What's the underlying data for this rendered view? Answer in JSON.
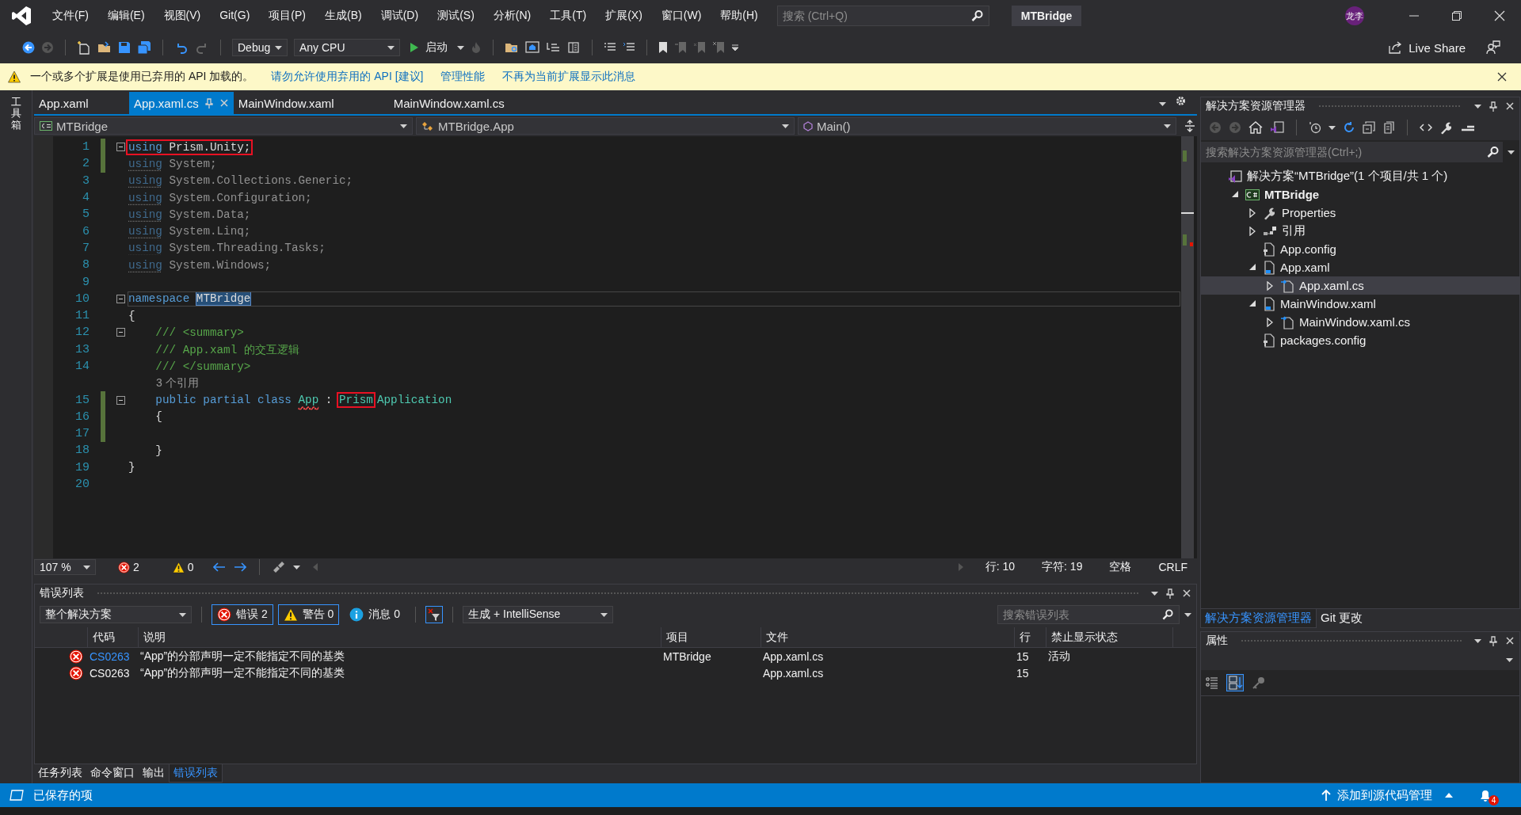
{
  "title_bar": {
    "menu": [
      "文件(F)",
      "编辑(E)",
      "视图(V)",
      "Git(G)",
      "项目(P)",
      "生成(B)",
      "调试(D)",
      "测试(S)",
      "分析(N)",
      "工具(T)",
      "扩展(X)",
      "窗口(W)",
      "帮助(H)"
    ],
    "search_placeholder": "搜索 (Ctrl+Q)",
    "title": "MTBridge",
    "avatar": "龙李"
  },
  "toolbar": {
    "configuration": "Debug",
    "platform": "Any CPU",
    "start": "启动",
    "live_share": "Live Share"
  },
  "info_bar": {
    "message": "一个或多个扩展是使用已弃用的 API 加载的。",
    "links": [
      "请勿允许使用弃用的 API [建议]",
      "管理性能",
      "不再为当前扩展显示此消息"
    ]
  },
  "toolbox_label": "工具箱",
  "editor_tabs": [
    {
      "label": "App.xaml",
      "selected": false
    },
    {
      "label": "App.xaml.cs",
      "selected": true
    },
    {
      "label": "MainWindow.xaml",
      "selected": false
    },
    {
      "label": "MainWindow.xaml.cs",
      "selected": false
    }
  ],
  "nav_bar": [
    "MTBridge",
    "MTBridge.App",
    "Main()"
  ],
  "code": [
    {
      "kind": "code",
      "n": "1",
      "changed": true,
      "fold": true,
      "unused": false,
      "current": false,
      "tokens": [
        {
          "text": "using",
          "kind": "keyword",
          "boxed": true
        },
        {
          "text": " Prism.Unity;",
          "kind": "plain",
          "boxed": true
        }
      ]
    },
    {
      "kind": "code",
      "n": "2",
      "changed": true,
      "fold": false,
      "unused": true,
      "current": false,
      "tokens": [
        {
          "text": "using",
          "kind": "keyword",
          "boxed": false
        },
        {
          "text": " System;",
          "kind": "plain",
          "boxed": false
        }
      ]
    },
    {
      "kind": "code",
      "n": "3",
      "changed": false,
      "fold": false,
      "unused": true,
      "current": false,
      "tokens": [
        {
          "text": "using",
          "kind": "keyword",
          "boxed": false
        },
        {
          "text": " System.Collections.Generic;",
          "kind": "plain",
          "boxed": false
        }
      ]
    },
    {
      "kind": "code",
      "n": "4",
      "changed": false,
      "fold": false,
      "unused": true,
      "current": false,
      "tokens": [
        {
          "text": "using",
          "kind": "keyword",
          "boxed": false
        },
        {
          "text": " System.Configuration;",
          "kind": "plain",
          "boxed": false
        }
      ]
    },
    {
      "kind": "code",
      "n": "5",
      "changed": false,
      "fold": false,
      "unused": true,
      "current": false,
      "tokens": [
        {
          "text": "using",
          "kind": "keyword",
          "boxed": false
        },
        {
          "text": " System.Data;",
          "kind": "plain",
          "boxed": false
        }
      ]
    },
    {
      "kind": "code",
      "n": "6",
      "changed": false,
      "fold": false,
      "unused": true,
      "current": false,
      "tokens": [
        {
          "text": "using",
          "kind": "keyword",
          "boxed": false
        },
        {
          "text": " System.Linq;",
          "kind": "plain",
          "boxed": false
        }
      ]
    },
    {
      "kind": "code",
      "n": "7",
      "changed": false,
      "fold": false,
      "unused": true,
      "current": false,
      "tokens": [
        {
          "text": "using",
          "kind": "keyword",
          "boxed": false
        },
        {
          "text": " System.Threading.Tasks;",
          "kind": "plain",
          "boxed": false
        }
      ]
    },
    {
      "kind": "code",
      "n": "8",
      "changed": false,
      "fold": false,
      "unused": true,
      "current": false,
      "tokens": [
        {
          "text": "using",
          "kind": "keyword",
          "boxed": false
        },
        {
          "text": " System.Windows;",
          "kind": "plain",
          "boxed": false
        }
      ]
    },
    {
      "kind": "code",
      "n": "9",
      "changed": false,
      "fold": false,
      "current": false
    },
    {
      "kind": "code",
      "n": "10",
      "changed": false,
      "fold": true,
      "unused": false,
      "current": true,
      "tokens": [
        {
          "text": "namespace ",
          "kind": "keyword",
          "boxed": false
        },
        {
          "text": "MTBridge",
          "kind": "selection",
          "boxed": false
        }
      ]
    },
    {
      "kind": "code",
      "n": "11",
      "changed": false,
      "fold": false,
      "unused": false,
      "current": false,
      "tokens": [
        {
          "text": "{",
          "kind": "plain",
          "boxed": false
        }
      ]
    },
    {
      "kind": "code",
      "n": "12",
      "changed": false,
      "fold": true,
      "unused": false,
      "current": false,
      "tokens": [
        {
          "text": "    /// <summary>",
          "kind": "comment",
          "boxed": false
        }
      ]
    },
    {
      "kind": "code",
      "n": "13",
      "changed": false,
      "fold": false,
      "unused": false,
      "current": false,
      "tokens": [
        {
          "text": "    /// App.xaml 的交互逻辑",
          "kind": "comment",
          "boxed": false
        }
      ]
    },
    {
      "kind": "code",
      "n": "14",
      "changed": false,
      "fold": false,
      "unused": false,
      "current": false,
      "tokens": [
        {
          "text": "    /// </summary>",
          "kind": "comment",
          "boxed": false
        }
      ]
    },
    {
      "kind": "codelens",
      "text": "3 个引用"
    },
    {
      "kind": "code",
      "n": "15",
      "changed": true,
      "fold": true,
      "unused": false,
      "current": false,
      "tokens": [
        {
          "text": "    public partial class ",
          "kind": "keyword",
          "boxed": false
        },
        {
          "text": "App",
          "kind": "type-error",
          "boxed": false
        },
        {
          "text": " : ",
          "kind": "plain",
          "boxed": false
        },
        {
          "text": "Prism",
          "kind": "type",
          "boxed": true
        },
        {
          "text": "Application",
          "kind": "type",
          "boxed": false
        }
      ]
    },
    {
      "kind": "code",
      "n": "16",
      "changed": true,
      "fold": false,
      "unused": false,
      "current": false,
      "tokens": [
        {
          "text": "    {",
          "kind": "plain",
          "boxed": false
        }
      ]
    },
    {
      "kind": "code",
      "n": "17",
      "changed": true,
      "fold": false,
      "current": false
    },
    {
      "kind": "code",
      "n": "18",
      "changed": false,
      "fold": false,
      "unused": false,
      "current": false,
      "tokens": [
        {
          "text": "    }",
          "kind": "plain",
          "boxed": false
        }
      ]
    },
    {
      "kind": "code",
      "n": "19",
      "changed": false,
      "fold": false,
      "unused": false,
      "current": false,
      "tokens": [
        {
          "text": "}",
          "kind": "plain",
          "boxed": false
        }
      ]
    },
    {
      "kind": "code",
      "n": "20",
      "changed": false,
      "fold": false,
      "current": false
    }
  ],
  "editor_status": {
    "zoom": "107 %",
    "errors": "2",
    "warnings": "0",
    "line": "行: 10",
    "char": "字符: 19",
    "spaces": "空格",
    "eol": "CRLF"
  },
  "error_list": {
    "title": "错误列表",
    "scope": "整个解决方案",
    "filters": [
      {
        "kind": "error",
        "label": "错误 2",
        "selected": true
      },
      {
        "kind": "warning",
        "label": "警告 0",
        "selected": true
      },
      {
        "kind": "info",
        "label": "消息 0",
        "selected": false
      }
    ],
    "source": "生成 + IntelliSense",
    "search_placeholder": "搜索错误列表",
    "columns": [
      "代码",
      "说明",
      "项目",
      "文件",
      "行",
      "禁止显示状态"
    ],
    "rows": [
      {
        "code": "CS0263",
        "linked": true,
        "description": "“App”的分部声明一定不能指定不同的基类",
        "project": "MTBridge",
        "file": "App.xaml.cs",
        "line": "15",
        "suppression": "活动"
      },
      {
        "code": "CS0263",
        "linked": false,
        "description": "“App”的分部声明一定不能指定不同的基类",
        "file": "App.xaml.cs",
        "line": "15"
      }
    ]
  },
  "bottom_tabs": [
    {
      "label": "任务列表",
      "selected": false
    },
    {
      "label": "命令窗口",
      "selected": false
    },
    {
      "label": "输出",
      "selected": false
    },
    {
      "label": "错误列表",
      "selected": true
    }
  ],
  "solution_explorer": {
    "title": "解决方案资源管理器",
    "search_placeholder": "搜索解决方案资源管理器(Ctrl+;)",
    "tree": [
      {
        "label": "解决方案“MTBridge”(1 个项目/共 1 个)",
        "kind": "solution",
        "selected": false,
        "children": [
          {
            "label": "MTBridge",
            "kind": "project",
            "expanded": true,
            "selected": false,
            "children": [
              {
                "label": "Properties",
                "kind": "wrench",
                "expanded": false,
                "selected": false
              },
              {
                "label": "引用",
                "kind": "references",
                "expanded": false,
                "selected": false
              },
              {
                "label": "App.config",
                "kind": "config",
                "selected": false
              },
              {
                "label": "App.xaml",
                "kind": "xaml",
                "expanded": true,
                "selected": false,
                "children": [
                  {
                    "label": "App.xaml.cs",
                    "kind": "cs",
                    "expanded": false,
                    "selected": true
                  }
                ]
              },
              {
                "label": "MainWindow.xaml",
                "kind": "xaml",
                "expanded": true,
                "selected": false,
                "children": [
                  {
                    "label": "MainWindow.xaml.cs",
                    "kind": "cs",
                    "expanded": false,
                    "selected": false
                  }
                ]
              },
              {
                "label": "packages.config",
                "kind": "config",
                "selected": false
              }
            ]
          }
        ]
      }
    ]
  },
  "side_tabs": [
    {
      "label": "解决方案资源管理器",
      "selected": true
    },
    {
      "label": "Git 更改",
      "selected": false
    }
  ],
  "properties": {
    "title": "属性"
  },
  "status_bar": {
    "message": "已保存的项",
    "source_control": "添加到源代码管理",
    "notifications": "4"
  }
}
